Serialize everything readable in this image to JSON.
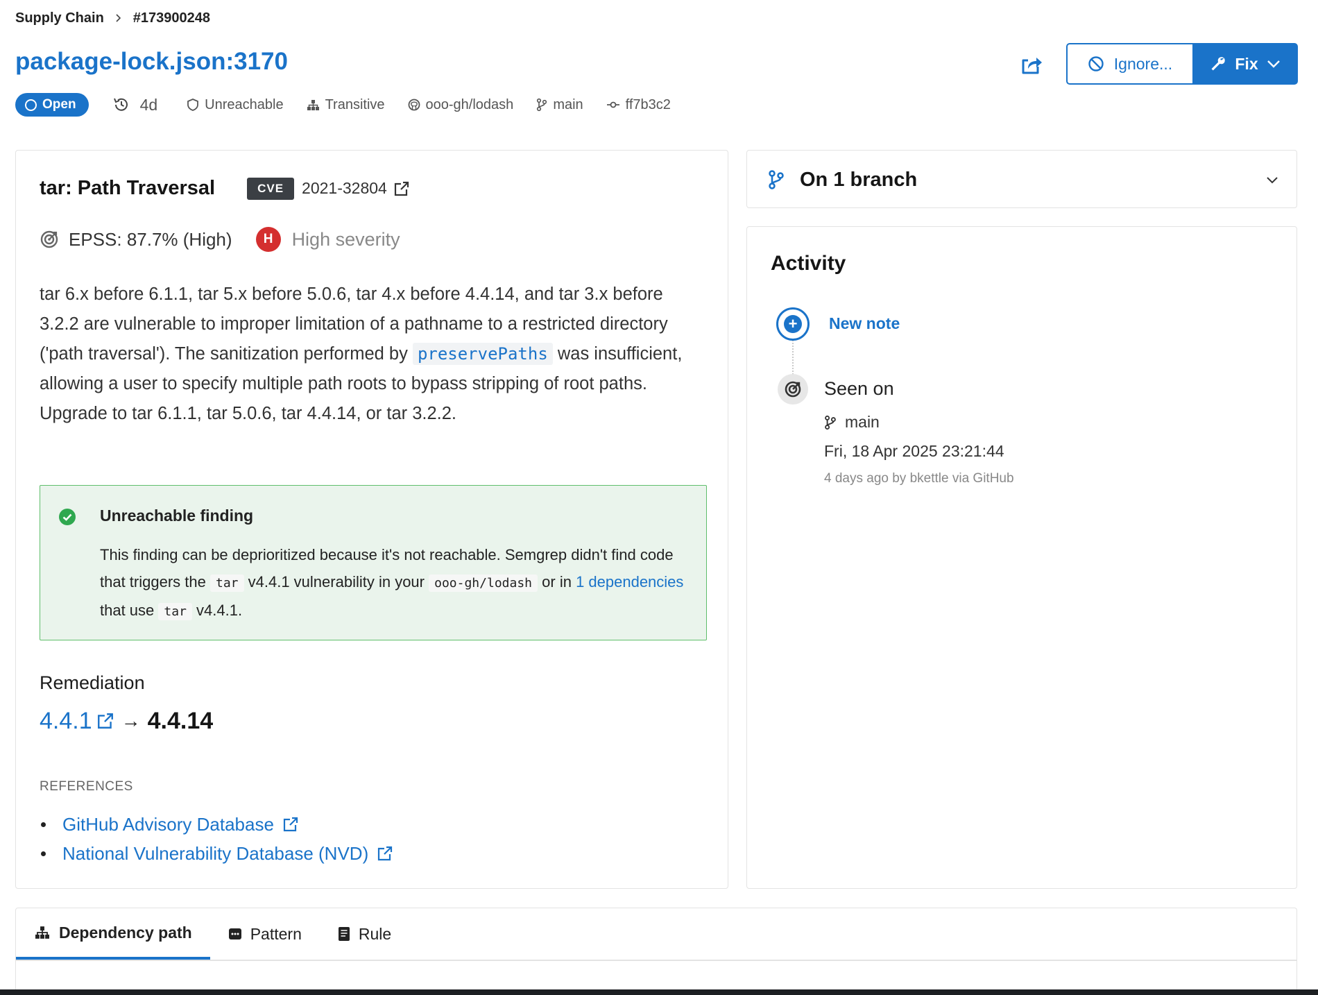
{
  "breadcrumb": {
    "section": "Supply Chain",
    "id": "#173900248"
  },
  "header": {
    "title": "package-lock.json:3170",
    "status": "Open",
    "age": "4d",
    "reachability": "Unreachable",
    "dependency_type": "Transitive",
    "repository": "ooo-gh/lodash",
    "branch": "main",
    "commit": "ff7b3c2",
    "ignore_label": "Ignore...",
    "fix_label": "Fix"
  },
  "finding": {
    "title": "tar: Path Traversal",
    "cve_tag": "CVE",
    "cve_id": "2021-32804",
    "epss": "EPSS: 87.7% (High)",
    "severity_letter": "H",
    "severity": "High severity",
    "description_1": "tar 6.x before 6.1.1, tar 5.x before 5.0.6, tar 4.x before 4.4.14, and tar 3.x before 3.2.2 are vulnerable to improper limitation of a pathname to a restricted directory ('path traversal'). The sanitization performed by",
    "description_code": "preservePaths",
    "description_2": "was insufficient, allowing a user to specify multiple path roots to bypass stripping of root paths. Upgrade to tar 6.1.1, tar 5.0.6, tar 4.4.14, or tar 3.2.2."
  },
  "reachability_box": {
    "title": "Unreachable finding",
    "text_1": "This finding can be deprioritized because it's not reachable. Semgrep didn't find code that triggers the",
    "package": "tar",
    "text_2": "v4.4.1 vulnerability in your",
    "repo": "ooo-gh/lodash",
    "text_3": "or in",
    "deps_link": "1 dependencies",
    "text_4": "that use",
    "package_2": "tar",
    "text_5": "v4.4.1."
  },
  "remediation": {
    "label": "Remediation",
    "from": "4.4.1",
    "arrow": "→",
    "to": "4.4.14"
  },
  "references": {
    "label": "REFERENCES",
    "items": [
      {
        "label": "GitHub Advisory Database"
      },
      {
        "label": "National Vulnerability Database (NVD)"
      }
    ]
  },
  "branches": {
    "title": "On 1 branch"
  },
  "activity": {
    "title": "Activity",
    "new_note": "New note",
    "seen_on": "Seen on",
    "seen_branch": "main",
    "seen_date": "Fri, 18 Apr 2025 23:21:44",
    "seen_by": "4 days ago by bkettle via GitHub"
  },
  "tabs": [
    {
      "label": "Dependency path",
      "icon": "sitemap-icon",
      "active": true
    },
    {
      "label": "Pattern",
      "icon": "pattern-icon",
      "active": false
    },
    {
      "label": "Rule",
      "icon": "rule-doc-icon",
      "active": false
    }
  ],
  "colors": {
    "accent": "#1a73c9",
    "severity_high": "#d42f2f",
    "reach_bg": "#eaf4ec",
    "reach_border": "#5fbe6b",
    "cve_tag_bg": "#3b3f44"
  }
}
